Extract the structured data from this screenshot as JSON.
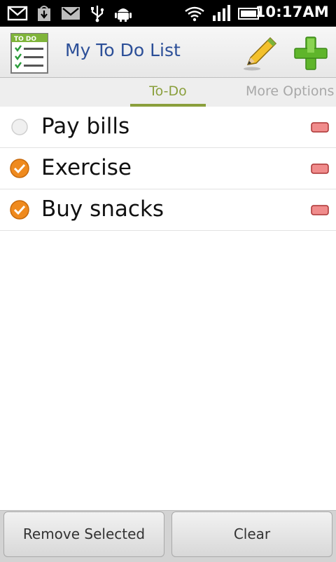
{
  "status_bar": {
    "time": "10:17AM",
    "icons": [
      "mail-icon",
      "download-icon",
      "gmail-icon",
      "usb-icon",
      "android-icon",
      "wifi-icon",
      "signal-icon",
      "battery-icon"
    ]
  },
  "header": {
    "title": "My To Do List",
    "app_icon_label": "TO DO",
    "edit_icon": "pencil-icon",
    "add_icon": "plus-icon"
  },
  "tabs": [
    {
      "label": "To-Do",
      "selected": true
    },
    {
      "label": "More Options",
      "selected": false
    }
  ],
  "items": [
    {
      "text": "Pay bills",
      "checked": false
    },
    {
      "text": "Exercise",
      "checked": true
    },
    {
      "text": "Buy snacks",
      "checked": true
    }
  ],
  "footer": {
    "remove_selected_label": "Remove Selected",
    "clear_label": "Clear"
  },
  "colors": {
    "title": "#2c4f98",
    "tab_active": "#8a9f3c",
    "check_orange": "#ef8a1e",
    "remove_red": "#f08c8c"
  }
}
